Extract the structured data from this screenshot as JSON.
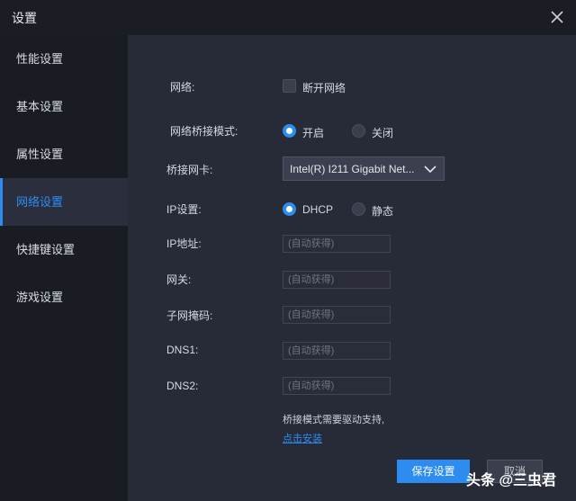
{
  "window": {
    "title": "设置"
  },
  "sidebar": {
    "items": [
      {
        "label": "性能设置"
      },
      {
        "label": "基本设置"
      },
      {
        "label": "属性设置"
      },
      {
        "label": "网络设置",
        "active": true
      },
      {
        "label": "快捷键设置"
      },
      {
        "label": "游戏设置"
      }
    ]
  },
  "network": {
    "label": "网络:",
    "disconnect_checkbox": {
      "label": "断开网络",
      "checked": false
    }
  },
  "bridge_mode": {
    "label": "网络桥接模式:",
    "options": [
      {
        "label": "开启",
        "selected": true
      },
      {
        "label": "关闭",
        "selected": false
      }
    ]
  },
  "bridge_nic": {
    "label": "桥接网卡:",
    "selected": "Intel(R) I211 Gigabit Net..."
  },
  "ip_settings": {
    "label": "IP设置:",
    "options": [
      {
        "label": "DHCP",
        "selected": true
      },
      {
        "label": "静态",
        "selected": false
      }
    ]
  },
  "fields": [
    {
      "label": "IP地址:",
      "placeholder": "(自动获得)"
    },
    {
      "label": "网关:",
      "placeholder": "(自动获得)"
    },
    {
      "label": "子网掩码:",
      "placeholder": "(自动获得)"
    },
    {
      "label": "DNS1:",
      "placeholder": "(自动获得)"
    },
    {
      "label": "DNS2:",
      "placeholder": "(自动获得)"
    }
  ],
  "notice": {
    "text": "桥接模式需要驱动支持,",
    "link": "点击安装"
  },
  "buttons": {
    "save": "保存设置",
    "cancel": "取消"
  },
  "watermark": "头条 @三虫君",
  "colors": {
    "accent": "#2d8cf0",
    "background": "#272a37",
    "sidebar": "#1a1c23"
  }
}
